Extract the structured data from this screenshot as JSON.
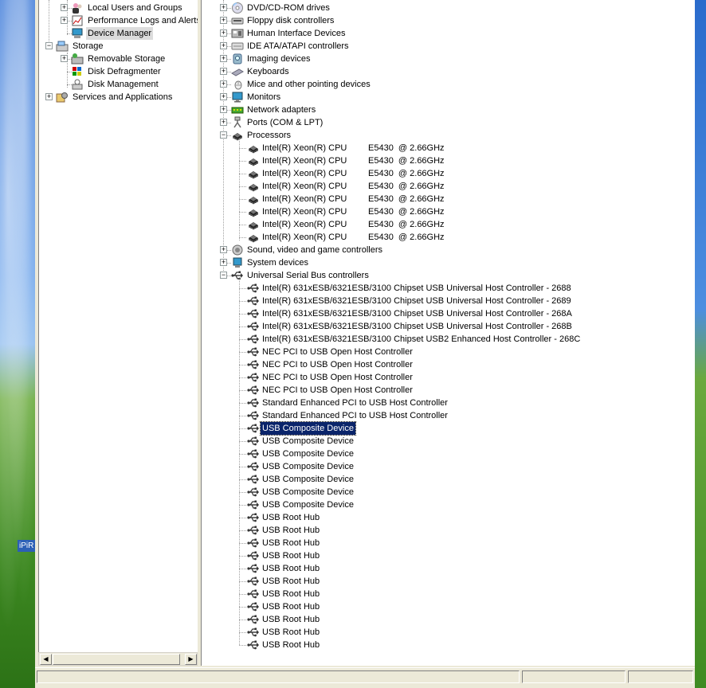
{
  "desktop": {
    "icon_label": "iPiR"
  },
  "left_tree": [
    {
      "label": "Local Users and Groups",
      "expander": "+",
      "icon": "users-icon"
    },
    {
      "label": "Performance Logs and Alerts",
      "expander": "+",
      "icon": "perf-logs-icon"
    },
    {
      "label": "Device Manager",
      "expander": "",
      "icon": "device-manager-icon",
      "selected": true
    },
    {
      "label": "Storage",
      "expander": "-",
      "icon": "storage-icon"
    },
    {
      "label": "Removable Storage",
      "expander": "+",
      "icon": "removable-storage-icon"
    },
    {
      "label": "Disk Defragmenter",
      "expander": "",
      "icon": "defrag-icon"
    },
    {
      "label": "Disk Management",
      "expander": "",
      "icon": "disk-mgmt-icon"
    },
    {
      "label": "Services and Applications",
      "expander": "+",
      "icon": "services-icon"
    }
  ],
  "categories": [
    {
      "label": "DVD/CD-ROM drives",
      "expander": "+",
      "icon": "dvd-icon"
    },
    {
      "label": "Floppy disk controllers",
      "expander": "+",
      "icon": "floppy-controller-icon"
    },
    {
      "label": "Human Interface Devices",
      "expander": "+",
      "icon": "hid-icon"
    },
    {
      "label": "IDE ATA/ATAPI controllers",
      "expander": "+",
      "icon": "ide-icon"
    },
    {
      "label": "Imaging devices",
      "expander": "+",
      "icon": "imaging-icon"
    },
    {
      "label": "Keyboards",
      "expander": "+",
      "icon": "keyboard-icon"
    },
    {
      "label": "Mice and other pointing devices",
      "expander": "+",
      "icon": "mouse-icon"
    },
    {
      "label": "Monitors",
      "expander": "+",
      "icon": "monitor-icon"
    },
    {
      "label": "Network adapters",
      "expander": "+",
      "icon": "network-icon"
    },
    {
      "label": "Ports (COM & LPT)",
      "expander": "+",
      "icon": "port-icon"
    },
    {
      "label": "Processors",
      "expander": "-",
      "icon": "processor-icon"
    }
  ],
  "processors": [
    {
      "name": "Intel(R) Xeon(R) CPU",
      "model": "E5430  @ 2.66GHz"
    },
    {
      "name": "Intel(R) Xeon(R) CPU",
      "model": "E5430  @ 2.66GHz"
    },
    {
      "name": "Intel(R) Xeon(R) CPU",
      "model": "E5430  @ 2.66GHz"
    },
    {
      "name": "Intel(R) Xeon(R) CPU",
      "model": "E5430  @ 2.66GHz"
    },
    {
      "name": "Intel(R) Xeon(R) CPU",
      "model": "E5430  @ 2.66GHz"
    },
    {
      "name": "Intel(R) Xeon(R) CPU",
      "model": "E5430  @ 2.66GHz"
    },
    {
      "name": "Intel(R) Xeon(R) CPU",
      "model": "E5430  @ 2.66GHz"
    },
    {
      "name": "Intel(R) Xeon(R) CPU",
      "model": "E5430  @ 2.66GHz"
    }
  ],
  "categories_after": [
    {
      "label": "Sound, video and game controllers",
      "expander": "+",
      "icon": "sound-icon"
    },
    {
      "label": "System devices",
      "expander": "+",
      "icon": "system-devices-icon"
    },
    {
      "label": "Universal Serial Bus controllers",
      "expander": "-",
      "icon": "usb-icon"
    }
  ],
  "usb_devices": [
    "Intel(R) 631xESB/6321ESB/3100 Chipset USB Universal Host Controller - 2688",
    "Intel(R) 631xESB/6321ESB/3100 Chipset USB Universal Host Controller - 2689",
    "Intel(R) 631xESB/6321ESB/3100 Chipset USB Universal Host Controller - 268A",
    "Intel(R) 631xESB/6321ESB/3100 Chipset USB Universal Host Controller - 268B",
    "Intel(R) 631xESB/6321ESB/3100 Chipset USB2 Enhanced Host Controller - 268C",
    "NEC PCI to USB Open Host Controller",
    "NEC PCI to USB Open Host Controller",
    "NEC PCI to USB Open Host Controller",
    "NEC PCI to USB Open Host Controller",
    "Standard Enhanced PCI to USB Host Controller",
    "Standard Enhanced PCI to USB Host Controller",
    "USB Composite Device",
    "USB Composite Device",
    "USB Composite Device",
    "USB Composite Device",
    "USB Composite Device",
    "USB Composite Device",
    "USB Composite Device",
    "USB Root Hub",
    "USB Root Hub",
    "USB Root Hub",
    "USB Root Hub",
    "USB Root Hub",
    "USB Root Hub",
    "USB Root Hub",
    "USB Root Hub",
    "USB Root Hub",
    "USB Root Hub",
    "USB Root Hub"
  ],
  "usb_selected_index": 11,
  "scrollbar": {
    "left_arrow": "◀",
    "right_arrow": "▶"
  }
}
